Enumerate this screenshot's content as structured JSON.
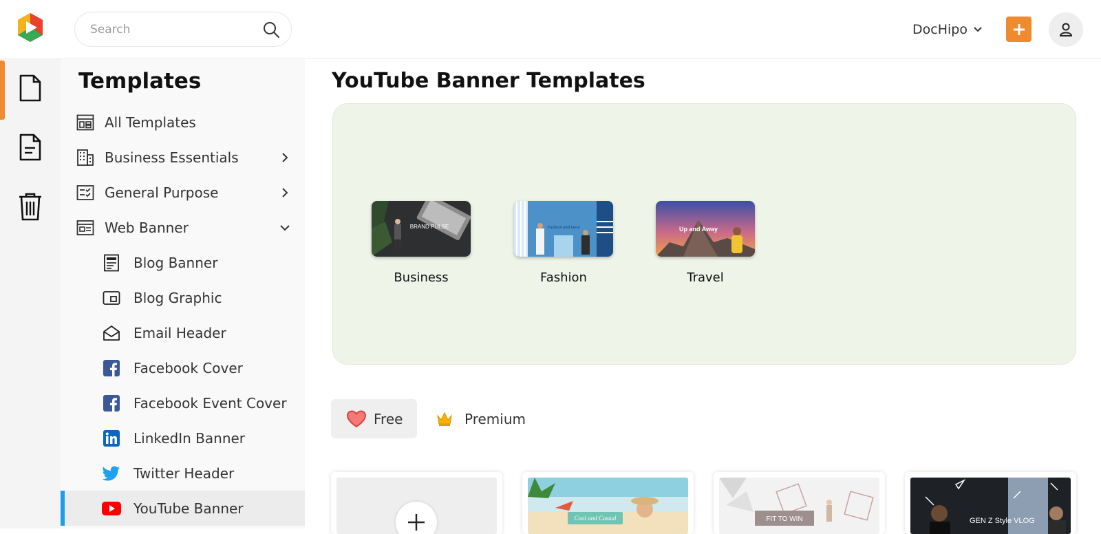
{
  "app": {
    "name": "DocHipo",
    "brand_color": "#f08a2f"
  },
  "search": {
    "placeholder": "Search",
    "value": "",
    "icon": "search-icon"
  },
  "header": {
    "workspace_label": "DocHipo",
    "add_icon": "plus-icon",
    "avatar_icon": "user-icon"
  },
  "rail": {
    "items": [
      {
        "icon": "document-icon",
        "active": true
      },
      {
        "icon": "text-document-icon",
        "active": false
      },
      {
        "icon": "trash-icon",
        "active": false
      }
    ]
  },
  "sidebar": {
    "title": "Templates",
    "items": [
      {
        "label": "All Templates",
        "icon": "layout-icon"
      },
      {
        "label": "Business Essentials",
        "icon": "building-icon",
        "expand": "right"
      },
      {
        "label": "General Purpose",
        "icon": "checklist-icon",
        "expand": "right"
      },
      {
        "label": "Web Banner",
        "icon": "web-banner-icon",
        "expand": "down"
      },
      {
        "label": "Blog Banner",
        "icon": "blog-banner-icon"
      },
      {
        "label": "Blog Graphic",
        "icon": "blog-graphic-icon"
      },
      {
        "label": "Email Header",
        "icon": "envelope-icon"
      },
      {
        "label": "Facebook Cover",
        "icon": "facebook-icon"
      },
      {
        "label": "Facebook Event Cover",
        "icon": "facebook-icon"
      },
      {
        "label": "LinkedIn Banner",
        "icon": "linkedin-icon"
      },
      {
        "label": "Twitter Header",
        "icon": "twitter-icon"
      },
      {
        "label": "YouTube Banner",
        "icon": "youtube-icon",
        "active": true
      }
    ]
  },
  "main": {
    "title": "YouTube Banner Templates",
    "categories": [
      {
        "label": "Business",
        "thumb_text": "BRAND PULSE"
      },
      {
        "label": "Fashion",
        "thumb_text": "Fashion and more"
      },
      {
        "label": "Travel",
        "thumb_text": "Up and Away"
      }
    ],
    "tabs": [
      {
        "label": "Free",
        "icon": "heart-icon",
        "active": true
      },
      {
        "label": "Premium",
        "icon": "crown-icon",
        "active": false
      }
    ],
    "templates": [
      {
        "kind": "blank",
        "icon": "plus-icon"
      },
      {
        "kind": "template",
        "thumb_text": "Cool and Casual"
      },
      {
        "kind": "template",
        "thumb_text": "FIT TO WIN"
      },
      {
        "kind": "template",
        "thumb_text": "GEN Z Style VLOG"
      }
    ]
  },
  "colors": {
    "accent": "#f08a2f",
    "active_nav": "#1e9be9",
    "hero_bg": "#eef4e8",
    "facebook": "#3b5998",
    "linkedin": "#0a66c2",
    "twitter": "#1da1f2",
    "youtube": "#ff0000"
  }
}
